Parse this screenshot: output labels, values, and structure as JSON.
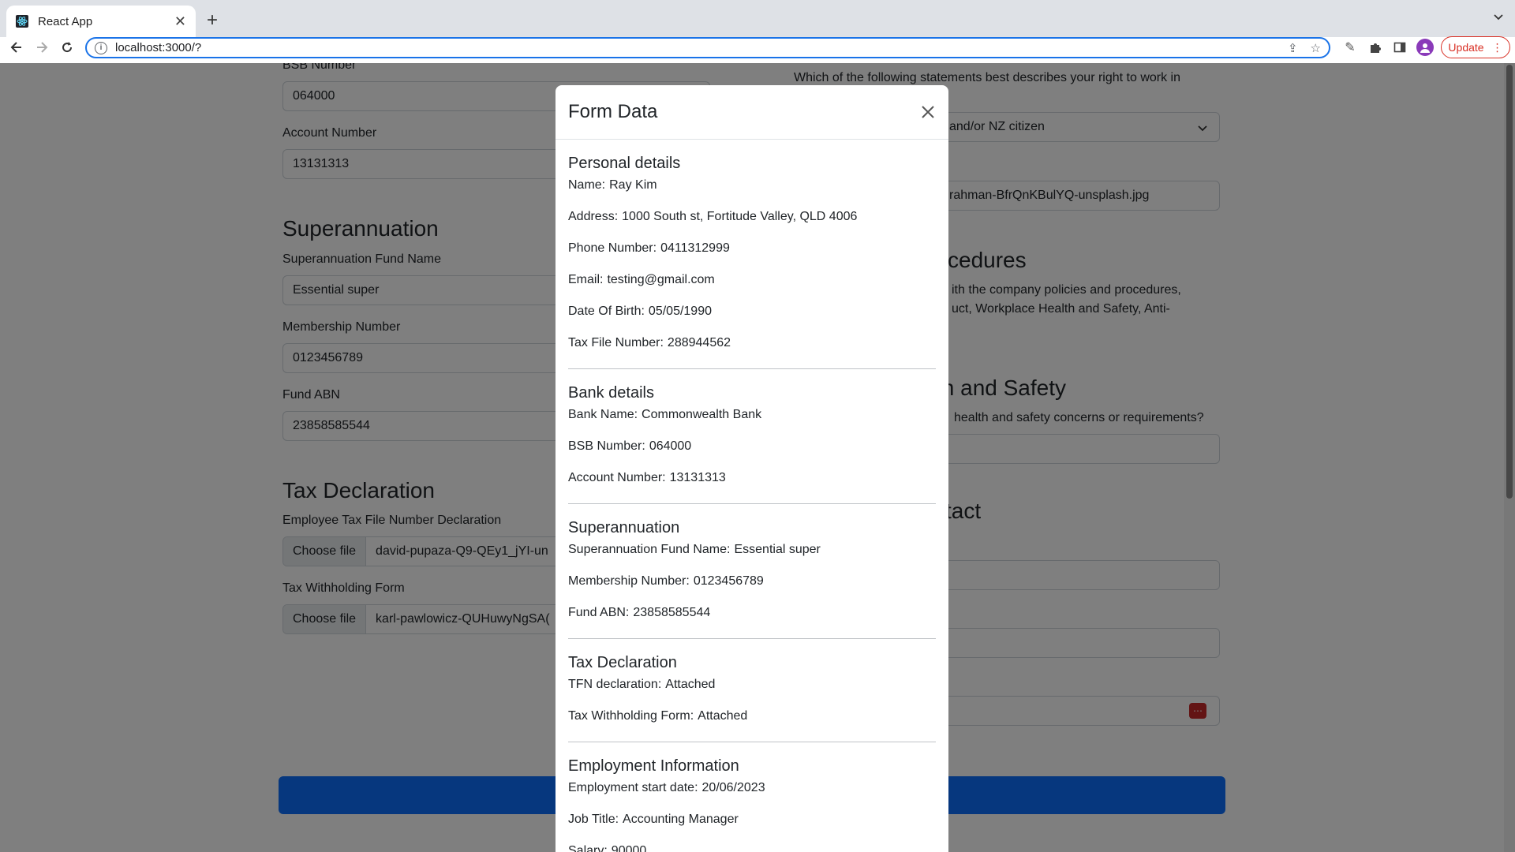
{
  "browser": {
    "tab_title": "React App",
    "url": "localhost:3000/?",
    "update_label": "Update"
  },
  "background": {
    "bank": {
      "bsb_label": "BSB Number",
      "bsb_value": "064000",
      "account_label": "Account Number",
      "account_value": "13131313"
    },
    "super": {
      "heading": "Superannuation",
      "fund_label": "Superannuation Fund Name",
      "fund_value": "Essential super",
      "membership_label": "Membership Number",
      "membership_value": "0123456789",
      "abn_label": "Fund ABN",
      "abn_value": "23858585544"
    },
    "tax": {
      "heading": "Tax Declaration",
      "tfn_label": "Employee Tax File Number Declaration",
      "choose_label": "Choose file",
      "tfn_file": "david-pupaza-Q9-QEy1_jYI-un",
      "withholding_label": "Tax Withholding Form",
      "withholding_file": "karl-pawlowicz-QUHuwyNgSA("
    },
    "right": {
      "right_to_work_q": "Which of the following statements best describes your right to work in",
      "right_to_work_value": "and/or NZ citizen",
      "photo_file": "rahman-BfrQnKBulYQ-unsplash.jpg",
      "policies_heading": "cedures",
      "policies_line1": "ith the company policies and procedures,",
      "policies_line2": "uct, Workplace Health and Safety, Anti-",
      "health_heading": "th and Safety",
      "health_q": "health and safety concerns or requirements?",
      "contact_heading": "tact"
    }
  },
  "modal": {
    "title": "Form Data",
    "sections": [
      {
        "title": "Personal details",
        "items": [
          {
            "k": "Name:",
            "v": "Ray Kim"
          },
          {
            "k": "Address:",
            "v": "1000 South st, Fortitude Valley, QLD 4006"
          },
          {
            "k": "Phone Number:",
            "v": "0411312999"
          },
          {
            "k": "Email:",
            "v": "testing@gmail.com"
          },
          {
            "k": "Date Of Birth:",
            "v": "05/05/1990"
          },
          {
            "k": "Tax File Number:",
            "v": "288944562"
          }
        ]
      },
      {
        "title": "Bank details",
        "items": [
          {
            "k": "Bank Name:",
            "v": "Commonwealth Bank"
          },
          {
            "k": "BSB Number:",
            "v": "064000"
          },
          {
            "k": "Account Number:",
            "v": "13131313"
          }
        ]
      },
      {
        "title": "Superannuation",
        "items": [
          {
            "k": "Superannuation Fund Name:",
            "v": "Essential super"
          },
          {
            "k": "Membership Number:",
            "v": "0123456789"
          },
          {
            "k": "Fund ABN:",
            "v": "23858585544"
          }
        ]
      },
      {
        "title": "Tax Declaration",
        "items": [
          {
            "k": "TFN declaration:",
            "v": "Attached"
          },
          {
            "k": "Tax Withholding Form:",
            "v": "Attached"
          }
        ]
      },
      {
        "title": "Employment Information",
        "items": [
          {
            "k": "Employment start date:",
            "v": "20/06/2023"
          },
          {
            "k": "Job Title:",
            "v": "Accounting Manager"
          },
          {
            "k": "Salary:",
            "v": "90000"
          }
        ]
      }
    ]
  }
}
